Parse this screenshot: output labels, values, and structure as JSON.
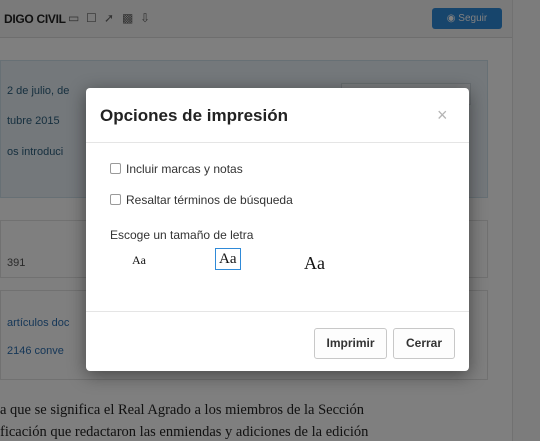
{
  "background": {
    "doc_title": "DIGO CIVIL",
    "follow_label": "Seguir",
    "toolbar_icons": [
      "folder-icon",
      "bookmark-icon",
      "share-icon",
      "print-icon",
      "download-icon"
    ],
    "info_lines": [
      "2 de julio, de",
      "tubre 2015",
      "os introduci"
    ],
    "row1_text": "391",
    "row2_lines": [
      "artículos doc",
      "2146 conve"
    ],
    "body_lines": [
      "a que se significa el Real Agrado a los miembros de la Sección",
      "ficación que redactaron las enmiendas y adiciones de la edición"
    ]
  },
  "modal": {
    "title": "Opciones de impresión",
    "close_symbol": "×",
    "options": [
      {
        "label": "Incluir marcas y notas",
        "checked": false
      },
      {
        "label": "Resaltar términos de búsqueda",
        "checked": false
      }
    ],
    "font_size_label": "Escoge un tamaño de letra",
    "font_sizes": [
      {
        "label": "Aa",
        "size": "small",
        "selected": false
      },
      {
        "label": "Aa",
        "size": "medium",
        "selected": true
      },
      {
        "label": "Aa",
        "size": "large",
        "selected": false
      }
    ],
    "buttons": {
      "print": "Imprimir",
      "close": "Cerrar"
    }
  },
  "colors": {
    "accent": "#2f8ad8",
    "backdrop": "rgba(0,0,0,0.5)",
    "info_bg": "#e8f1f6"
  }
}
